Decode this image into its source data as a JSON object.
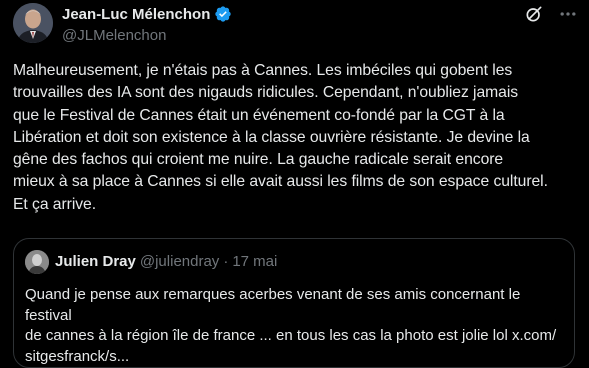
{
  "tweet": {
    "author": {
      "display_name": "Jean-Luc Mélenchon",
      "handle": "@JLMelenchon",
      "verified_icon": "verified-badge-icon",
      "verified_color": "#1d9bf0"
    },
    "actions": {
      "grok_icon": "grok-icon",
      "more_icon": "more-options-icon"
    },
    "text": "Malheureusement, je n'étais pas à Cannes. Les imbéciles qui gobent les\ntrouvailles des IA sont des nigauds ridicules. Cependant, n'oubliez jamais\nque le Festival de Cannes était un événement co-fondé par la CGT à la\nLibération et doit son existence à la classe ouvrière résistante. Je devine la\ngêne des fachos qui croient me nuire. La gauche radicale serait encore\nmieux à sa place à Cannes si elle avait aussi les films de son espace culturel.\nEt ça arrive."
  },
  "quote": {
    "display_name": "Julien Dray",
    "handle": "@juliendray",
    "separator": "·",
    "date": "17 mai",
    "text": "Quand je pense aux remarques acerbes venant de ses amis concernant le festival\nde cannes à la région île de france ... en tous les cas la photo est jolie lol x.com/\nsitgesfranck/s..."
  },
  "colors": {
    "background": "#000000",
    "primary_text": "#e7e9ea",
    "secondary_text": "#71767b",
    "border": "#2f3336",
    "accent": "#1d9bf0"
  }
}
